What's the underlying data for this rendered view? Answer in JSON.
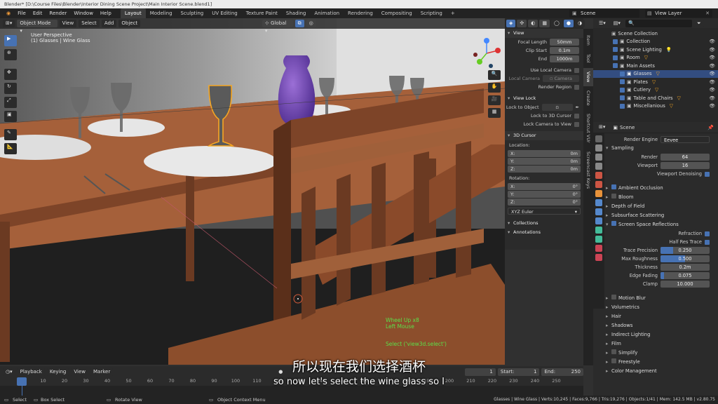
{
  "window_title": "Blender* [D:\\Course Files\\Blender\\Interior Dining Scene Project\\Main Interior Scene.blend1]",
  "top_menu": [
    "File",
    "Edit",
    "Render",
    "Window",
    "Help"
  ],
  "workspaces": [
    "Layout",
    "Modeling",
    "Sculpting",
    "UV Editing",
    "Texture Paint",
    "Shading",
    "Animation",
    "Rendering",
    "Compositing",
    "Scripting"
  ],
  "workspace_add": "+",
  "scene_name": "Scene",
  "view_layer": "View Layer",
  "viewport": {
    "mode": "Object Mode",
    "menus": [
      "View",
      "Select",
      "Add",
      "Object"
    ],
    "transform_orientation": "Global",
    "overlay_title": "User Perspective",
    "overlay_subtitle": "(1) Glasses | Wine Glass",
    "operator_log": [
      "Wheel Up x8",
      "Left Mouse",
      "",
      "Select ('view3d.select')"
    ]
  },
  "npanel": {
    "view_header": "View",
    "focal_length_label": "Focal Length",
    "focal_length": "50mm",
    "clip_start_label": "Clip Start",
    "clip_start": "0.1m",
    "end_label": "End",
    "clip_end": "1000m",
    "use_local_camera": "Use Local Camera",
    "local_camera_label": "Local Camera",
    "local_camera": "Camera",
    "render_region": "Render Region",
    "view_lock_header": "View Lock",
    "lock_to_object": "Lock to Object",
    "lock_to_3d_cursor": "Lock to 3D Cursor",
    "lock_camera_to_view": "Lock Camera to View",
    "cursor_header": "3D Cursor",
    "location_label": "Location:",
    "rotation_label": "Rotation:",
    "loc": [
      {
        "axis": "X:",
        "value": "0m"
      },
      {
        "axis": "Y:",
        "value": "0m"
      },
      {
        "axis": "Z:",
        "value": "0m"
      }
    ],
    "rot": [
      {
        "axis": "X:",
        "value": "0°"
      },
      {
        "axis": "Y:",
        "value": "0°"
      },
      {
        "axis": "Z:",
        "value": "0°"
      }
    ],
    "rotation_mode": "XYZ Euler",
    "collections": "Collections",
    "annotations": "Annotations"
  },
  "vertical_tabs": [
    "Item",
    "Tool",
    "View",
    "Create",
    "Shortcut VUr",
    "Screencast Keys"
  ],
  "outliner": {
    "root": "Scene Collection",
    "items": [
      {
        "label": "Collection",
        "depth": 1
      },
      {
        "label": "Scene Lighting",
        "depth": 1
      },
      {
        "label": "Room",
        "depth": 1
      },
      {
        "label": "Main Assets",
        "depth": 1
      },
      {
        "label": "Glasses",
        "depth": 2,
        "selected": true
      },
      {
        "label": "Plates",
        "depth": 2
      },
      {
        "label": "Cutlery",
        "depth": 2
      },
      {
        "label": "Table and Chairs",
        "depth": 2
      },
      {
        "label": "Miscellanious",
        "depth": 2
      }
    ]
  },
  "properties": {
    "scene_label": "Scene",
    "render_engine_label": "Render Engine",
    "render_engine": "Eevee",
    "sampling": "Sampling",
    "render_label": "Render",
    "render_samples": "64",
    "viewport_label": "Viewport",
    "viewport_samples": "16",
    "viewport_denoising": "Viewport Denoising",
    "sections_mid": [
      "Ambient Occlusion",
      "Bloom",
      "Depth of Field",
      "Subsurface Scattering",
      "Screen Space Reflections"
    ],
    "refraction": "Refraction",
    "half_res_trace": "Half Res Trace",
    "ssr_fields": [
      {
        "label": "Trace Precision",
        "value": "0.250",
        "fill": 0.25
      },
      {
        "label": "Max Roughness",
        "value": "0.500",
        "fill": 0.5
      },
      {
        "label": "Thickness",
        "value": "0.2m",
        "fill": 0
      },
      {
        "label": "Edge Fading",
        "value": "0.075",
        "fill": 0.075
      },
      {
        "label": "Clamp",
        "value": "10.000",
        "fill": 0
      }
    ],
    "sections_bottom": [
      "Motion Blur",
      "Volumetrics",
      "Hair",
      "Shadows",
      "Indirect Lighting",
      "Film",
      "Simplify",
      "Freestyle",
      "Color Management"
    ]
  },
  "timeline": {
    "menus": [
      "Playback",
      "Keying",
      "View",
      "Marker"
    ],
    "current_frame": "1",
    "start_label": "Start:",
    "start": "1",
    "end_label": "End:",
    "end": "250",
    "ticks": [
      "1",
      "10",
      "20",
      "30",
      "40",
      "50",
      "60",
      "70",
      "80",
      "90",
      "100",
      "110",
      "120",
      "130",
      "140",
      "150",
      "160",
      "170",
      "180",
      "190",
      "200",
      "210",
      "220",
      "230",
      "240",
      "250"
    ]
  },
  "statusbar": {
    "select": "Select",
    "box_select": "Box Select",
    "rotate_view": "Rotate View",
    "context_menu": "Object Context Menu",
    "stats": "Glasses | Wine Glass | Verts:10,245 | Faces:9,766 | Tris:19,276 | Objects:1/41 | Mem: 142.5 MB | v2.80.75"
  },
  "subtitles": {
    "cn": "所以现在我们选择酒杯",
    "en": "so now let's select the wine glass so I"
  },
  "colors": {
    "accent": "#4772b3",
    "selection": "#f5a623",
    "green_log": "#5ce04a"
  }
}
